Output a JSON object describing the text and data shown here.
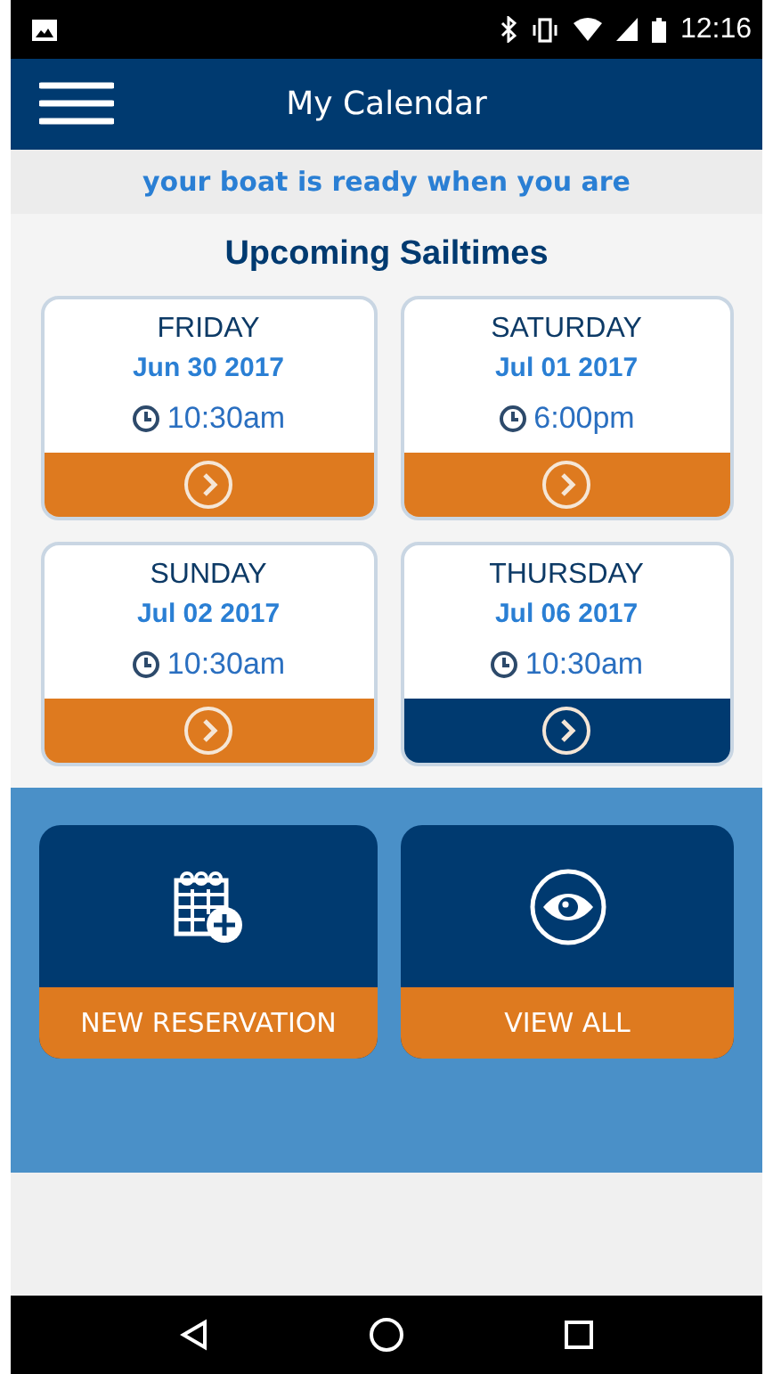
{
  "status_bar": {
    "time": "12:16"
  },
  "app_bar": {
    "title": "My Calendar"
  },
  "tagline": "your boat is ready when you are",
  "section_title": "Upcoming Sailtimes",
  "sailtimes": [
    {
      "day": "FRIDAY",
      "date": "Jun 30 2017",
      "time": "10:30am",
      "color": "#de7a1f"
    },
    {
      "day": "SATURDAY",
      "date": "Jul 01 2017",
      "time": "6:00pm",
      "color": "#de7a1f"
    },
    {
      "day": "SUNDAY",
      "date": "Jul 02 2017",
      "time": "10:30am",
      "color": "#de7a1f"
    },
    {
      "day": "THURSDAY",
      "date": "Jul 06 2017",
      "time": "10:30am",
      "color": "#003a70"
    }
  ],
  "actions": [
    {
      "kind": "calendar",
      "label": "NEW RESERVATION"
    },
    {
      "kind": "eye",
      "label": "VIEW ALL"
    }
  ]
}
